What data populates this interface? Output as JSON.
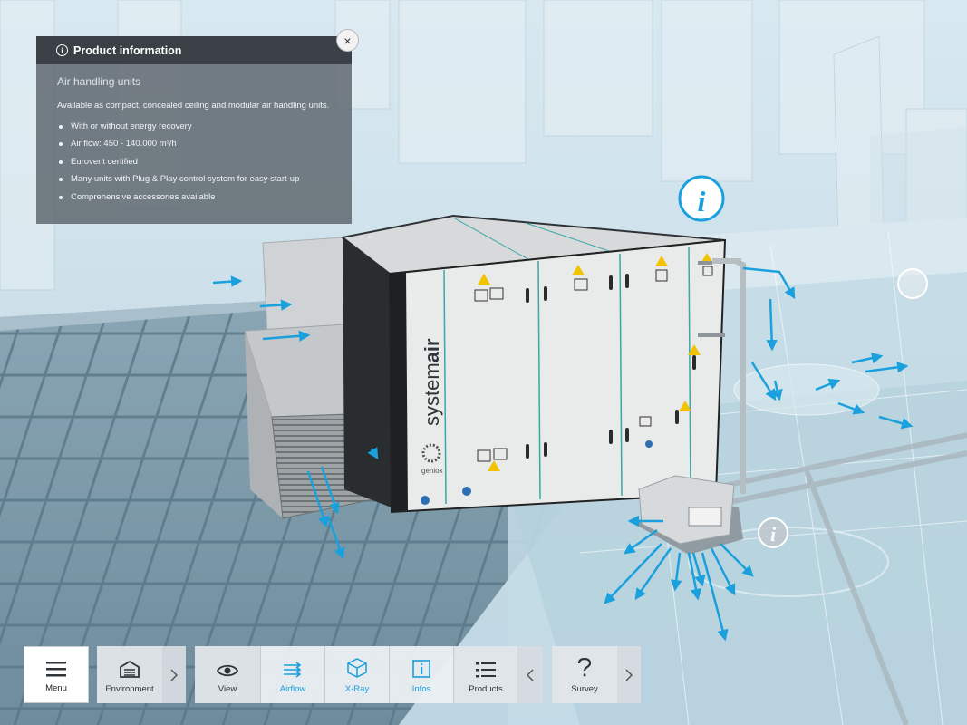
{
  "panel": {
    "title": "Product information",
    "subtitle": "Air handling units",
    "description": "Available as compact, concealed ceiling and modular air handling units.",
    "features": [
      "With or without energy recovery",
      "Air flow: 450 - 140.000 m³/h",
      "Eurovent certified",
      "Many units with Plug & Play control system for easy start-up",
      "Comprehensive accessories available"
    ],
    "close_glyph": "×"
  },
  "unit": {
    "brand_prefix": "system",
    "brand_suffix": "air",
    "sub_brand": "geniox"
  },
  "toolbar": {
    "menu": "Menu",
    "environment": "Environment",
    "view": "View",
    "airflow": "Airflow",
    "xray": "X-Ray",
    "infos": "Infos",
    "products": "Products",
    "survey": "Survey",
    "active": [
      "Airflow",
      "X-Ray",
      "Infos"
    ]
  },
  "colors": {
    "accent": "#1a9fd8",
    "panel_header": "#3a4046",
    "unit_body": "#e9eaea"
  },
  "icons": {
    "menu": "hamburger-icon",
    "environment": "garage-icon",
    "view": "eye-icon",
    "airflow": "airflow-arrows-icon",
    "xray": "cube-icon",
    "infos": "info-icon",
    "products": "list-icon",
    "survey": "question-icon"
  }
}
